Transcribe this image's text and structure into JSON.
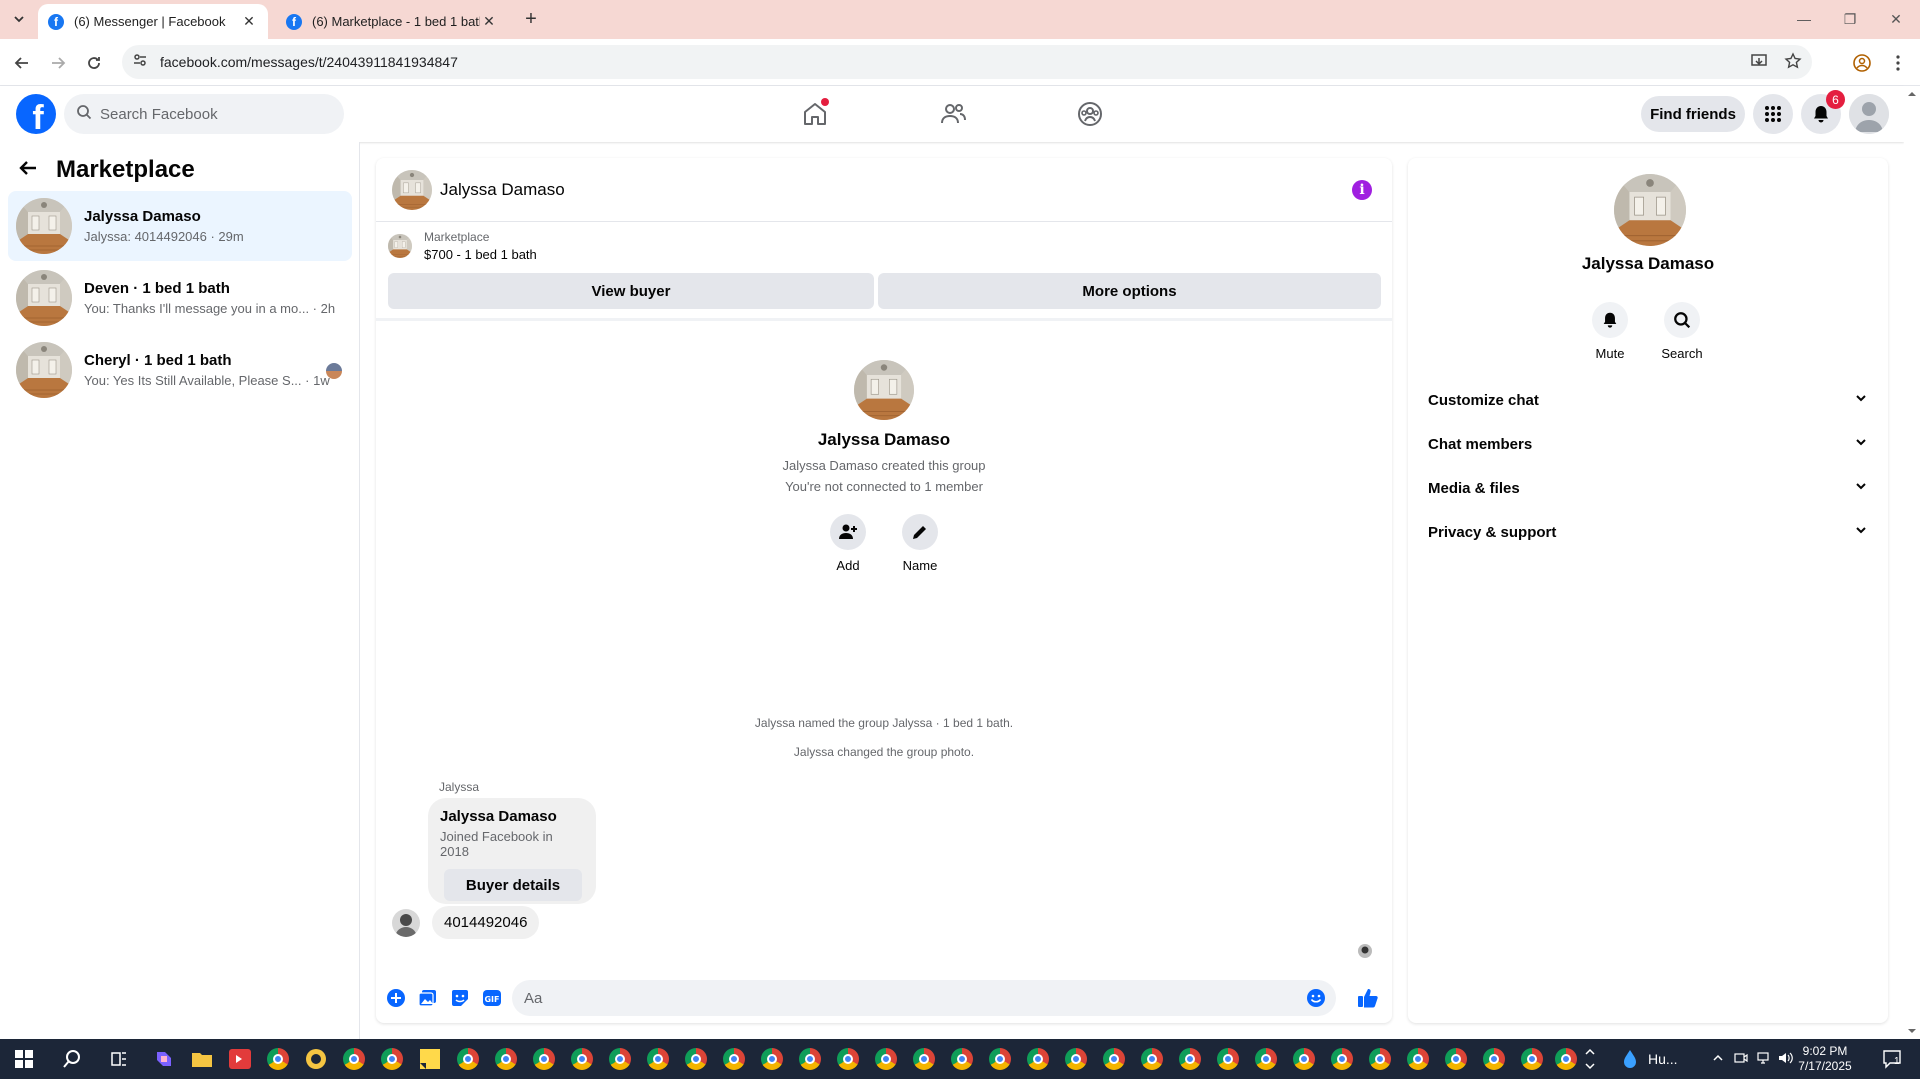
{
  "browser": {
    "tabs": [
      {
        "title": "(6) Messenger | Facebook",
        "active": true
      },
      {
        "title": "(6) Marketplace - 1 bed 1 bath",
        "active": false
      }
    ],
    "url": "facebook.com/messages/t/24043911841934847"
  },
  "fb_header": {
    "search_placeholder": "Search Facebook",
    "find_friends_label": "Find friends",
    "notification_count": "6"
  },
  "sidebar": {
    "title": "Marketplace",
    "conversations": [
      {
        "name": "Jalyssa Damaso",
        "last": "Jalyssa: 4014492046 · 29m",
        "selected": true
      },
      {
        "name": "Deven · 1 bed 1 bath",
        "last": "You: Thanks I'll message you in a mo... · 2h",
        "selected": false
      },
      {
        "name": "Cheryl · 1 bed 1 bath",
        "last": "You: Yes Its Still Available, Please S... · 1w",
        "selected": false
      }
    ]
  },
  "chat": {
    "contact_name": "Jalyssa Damaso",
    "listing_label": "Marketplace",
    "listing_title": "$700 - 1 bed 1 bath",
    "view_buyer_label": "View buyer",
    "more_options_label": "More options",
    "intro": {
      "name": "Jalyssa Damaso",
      "created": "Jalyssa Damaso created this group",
      "connected": "You're not connected to 1 member",
      "add_label": "Add",
      "name_label": "Name"
    },
    "system_messages": [
      "Jalyssa named the group Jalyssa · 1 bed 1 bath.",
      "Jalyssa changed the group photo."
    ],
    "sender_label": "Jalyssa",
    "buyer_card": {
      "name": "Jalyssa Damaso",
      "joined": "Joined Facebook in 2018",
      "button_label": "Buyer details"
    },
    "message_text": "4014492046",
    "composer_placeholder": "Aa"
  },
  "details": {
    "name": "Jalyssa Damaso",
    "mute_label": "Mute",
    "search_label": "Search",
    "sections": [
      "Customize chat",
      "Chat members",
      "Media & files",
      "Privacy & support"
    ]
  },
  "taskbar": {
    "weather_label": "Hu...",
    "time": "9:02 PM",
    "date": "7/17/2025",
    "notification_count": "1"
  },
  "colors": {
    "facebook_blue": "#0866ff",
    "selected_bg": "#ebf5ff",
    "info_purple": "#a01fe0",
    "badge_red": "#e41e3f",
    "tab_strip": "#f6d8d3"
  }
}
